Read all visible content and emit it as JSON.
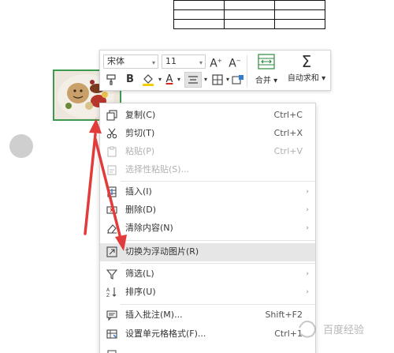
{
  "toolbar": {
    "font_name": "宋体",
    "font_size": "11",
    "increase_font": "A",
    "decrease_font": "A",
    "bold": "B",
    "font_color_letter": "A",
    "merge_label": "合并",
    "autosum_label": "自动求和",
    "autosum_symbol": "Σ"
  },
  "menu": {
    "items": [
      {
        "label": "复制(C)",
        "shortcut": "Ctrl+C",
        "icon": "copy-icon"
      },
      {
        "label": "剪切(T)",
        "shortcut": "Ctrl+X",
        "icon": "scissors-icon"
      },
      {
        "label": "粘贴(P)",
        "shortcut": "Ctrl+V",
        "icon": "paste-icon",
        "disabled": true
      },
      {
        "label": "选择性粘贴(S)...",
        "shortcut": "",
        "icon": "paste-special-icon",
        "disabled": true
      },
      {
        "label": "插入(I)",
        "shortcut": "",
        "icon": "insert-icon",
        "submenu": true
      },
      {
        "label": "删除(D)",
        "shortcut": "",
        "icon": "delete-icon",
        "submenu": true
      },
      {
        "label": "清除内容(N)",
        "shortcut": "",
        "icon": "eraser-icon",
        "submenu": true
      },
      {
        "label": "切换为浮动图片(R)",
        "shortcut": "",
        "icon": "float-picture-icon",
        "highlight": true
      },
      {
        "label": "筛选(L)",
        "shortcut": "",
        "icon": "filter-icon",
        "submenu": true
      },
      {
        "label": "排序(U)",
        "shortcut": "",
        "icon": "sort-icon",
        "submenu": true
      },
      {
        "label": "插入批注(M)...",
        "shortcut": "Shift+F2",
        "icon": "comment-icon"
      },
      {
        "label": "设置单元格格式(F)...",
        "shortcut": "Ctrl+1",
        "icon": "format-cells-icon"
      }
    ]
  },
  "watermark": {
    "text": "百度经验"
  },
  "colors": {
    "picture_border": "#3d9a4f",
    "annotation": "#e23b3b",
    "highlight": "#e6e6e6"
  }
}
